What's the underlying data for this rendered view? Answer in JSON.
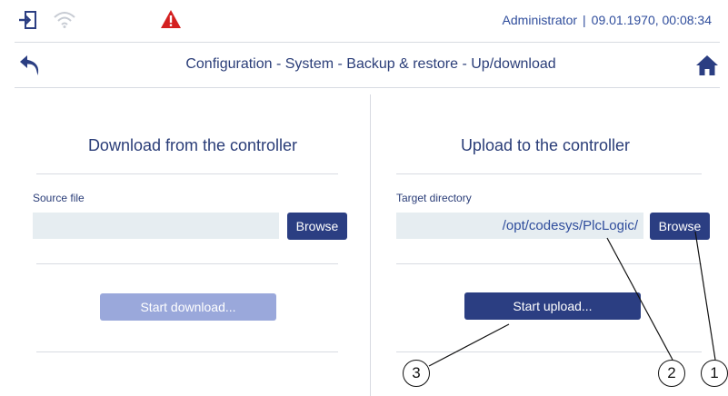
{
  "status_bar": {
    "user": "Administrator",
    "separator": "|",
    "datetime": "09.01.1970, 00:08:34",
    "icons": [
      "login-icon",
      "wifi-icon",
      "warning-icon"
    ],
    "warning_color": "#d42020"
  },
  "header": {
    "title": "Configuration - System - Backup & restore - Up/download",
    "icons": [
      "back-icon",
      "home-icon"
    ]
  },
  "download_panel": {
    "title": "Download from the controller",
    "source_label": "Source file",
    "source_value": "",
    "browse_label": "Browse",
    "start_label": "Start download..."
  },
  "upload_panel": {
    "title": "Upload to the controller",
    "target_label": "Target directory",
    "target_value": "/opt/codesys/PlcLogic/",
    "browse_label": "Browse",
    "start_label": "Start upload..."
  },
  "callouts": {
    "one": "1",
    "two": "2",
    "three": "3"
  },
  "colors": {
    "primary_button": "#2b3e82",
    "disabled_button": "#9aa8db",
    "field_background": "#e6edf1",
    "text": "#2a3d78"
  }
}
